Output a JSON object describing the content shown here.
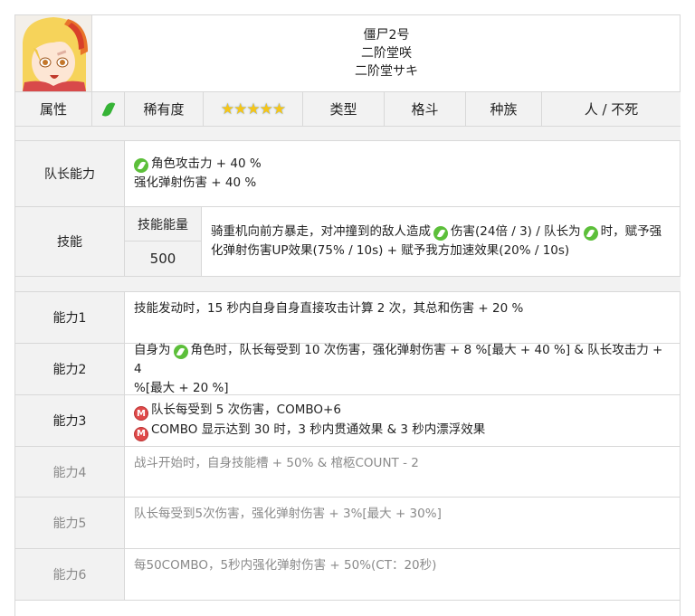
{
  "header": {
    "name_line1": "僵尸2号",
    "name_line2": "二阶堂咲",
    "name_line3": "二阶堂サキ"
  },
  "attributes": {
    "attribute_label": "属性",
    "attribute_icon": "leaf-icon",
    "rarity_label": "稀有度",
    "rarity_stars": 5,
    "type_label": "类型",
    "type_value": "格斗",
    "race_label": "种族",
    "race_value": "人 / 不死"
  },
  "leader": {
    "label": "队长能力",
    "line1": "角色攻击力 + 40 %",
    "line2": "强化弹射伤害 + 40 %"
  },
  "skill": {
    "label": "技能",
    "energy_label": "技能能量",
    "energy_value": "500",
    "text_a": "骑重机向前方暴走，对冲撞到的敌人造成",
    "text_b": "伤害(24倍 / 3) / 队长为",
    "text_c": "时，赋予强",
    "text_d": "化弹射伤害UP效果(75% / 10s) + 赋予我方加速效果(20% / 10s)"
  },
  "abilities": [
    {
      "label": "能力1",
      "text": "技能发动时，15 秒内自身自身直接攻击计算 2 次，其总和伤害 + 20 %"
    },
    {
      "label": "能力2",
      "pre": "自身为",
      "post": "角色时，队长每受到 10 次伤害，强化弹射伤害 + 8 %[最大 + 40 %] & 队长攻击力 + 4",
      "line2": "%[最大 + 20 %]"
    },
    {
      "label": "能力3",
      "line1": "队长每受到 5 次伤害，COMBO+6",
      "line2": "COMBO 显示达到 30 时，3 秒内贯通效果 & 3 秒内漂浮效果"
    },
    {
      "label": "能力4",
      "text": "战斗开始时，自身技能槽 + 50% & 棺柩COUNT - 2"
    },
    {
      "label": "能力5",
      "text": "队长每受到5次伤害，强化弹射伤害 + 3%[最大 + 30%]"
    },
    {
      "label": "能力6",
      "text": "每50COMBO，5秒内强化弹射伤害 + 50%(CT：20秒)"
    }
  ],
  "colors": {
    "attribute_green": "#36b336",
    "m_icon_red": "#e04a4a",
    "border": "#d8d8d8",
    "header_gray": "#f2f2f2",
    "muted_text": "#8a8a8a"
  }
}
